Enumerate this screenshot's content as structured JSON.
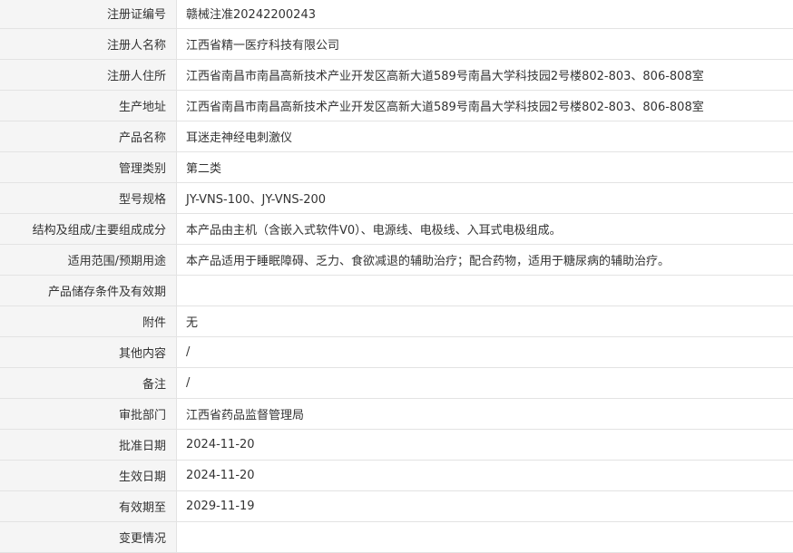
{
  "rows": [
    {
      "label": "注册证编号",
      "value": "赣械注准20242200243"
    },
    {
      "label": "注册人名称",
      "value": "江西省精一医疗科技有限公司"
    },
    {
      "label": "注册人住所",
      "value": "江西省南昌市南昌高新技术产业开发区高新大道589号南昌大学科技园2号楼802-803、806-808室"
    },
    {
      "label": "生产地址",
      "value": "江西省南昌市南昌高新技术产业开发区高新大道589号南昌大学科技园2号楼802-803、806-808室"
    },
    {
      "label": "产品名称",
      "value": "耳迷走神经电刺激仪"
    },
    {
      "label": "管理类别",
      "value": "第二类"
    },
    {
      "label": "型号规格",
      "value": "JY-VNS-100、JY-VNS-200"
    },
    {
      "label": "结构及组成/主要组成成分",
      "value": "本产品由主机（含嵌入式软件V0）、电源线、电极线、入耳式电极组成。"
    },
    {
      "label": "适用范围/预期用途",
      "value": "本产品适用于睡眠障碍、乏力、食欲减退的辅助治疗；配合药物，适用于糖尿病的辅助治疗。"
    },
    {
      "label": "产品储存条件及有效期",
      "value": ""
    },
    {
      "label": "附件",
      "value": "无"
    },
    {
      "label": "其他内容",
      "value": "/"
    },
    {
      "label": "备注",
      "value": "/"
    },
    {
      "label": "审批部门",
      "value": "江西省药品监督管理局"
    },
    {
      "label": "批准日期",
      "value": "2024-11-20"
    },
    {
      "label": "生效日期",
      "value": "2024-11-20"
    },
    {
      "label": "有效期至",
      "value": "2029-11-19"
    },
    {
      "label": "变更情况",
      "value": ""
    }
  ]
}
